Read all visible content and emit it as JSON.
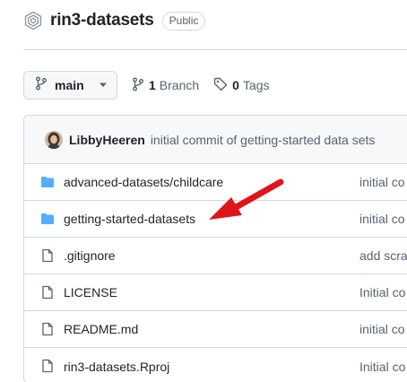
{
  "repo": {
    "name": "rin3-datasets",
    "visibility": "Public"
  },
  "toolbar": {
    "branch": "main",
    "branches_count": "1",
    "branches_label": "Branch",
    "tags_count": "0",
    "tags_label": "Tags"
  },
  "latest_commit": {
    "author": "LibbyHeeren",
    "message": "initial commit of getting-started data sets"
  },
  "files": [
    {
      "type": "folder",
      "name": "advanced-datasets/childcare",
      "commit": "initial co"
    },
    {
      "type": "folder",
      "name": "getting-started-datasets",
      "commit": "initial co"
    },
    {
      "type": "file",
      "name": ".gitignore",
      "commit": "add scra"
    },
    {
      "type": "file",
      "name": "LICENSE",
      "commit": "Initial co"
    },
    {
      "type": "file",
      "name": "README.md",
      "commit": "initial co"
    },
    {
      "type": "file",
      "name": "rin3-datasets.Rproj",
      "commit": "Initial co"
    }
  ],
  "colors": {
    "folder": "#54aeff",
    "arrow": "#e0141c",
    "muted": "#59636e",
    "border": "#d1d9e0"
  },
  "icons": {
    "repo": "repo-icon",
    "branch": "git-branch-icon",
    "tag": "tag-icon",
    "folder": "folder-icon",
    "file": "file-icon",
    "caret": "triangle-down-icon"
  }
}
